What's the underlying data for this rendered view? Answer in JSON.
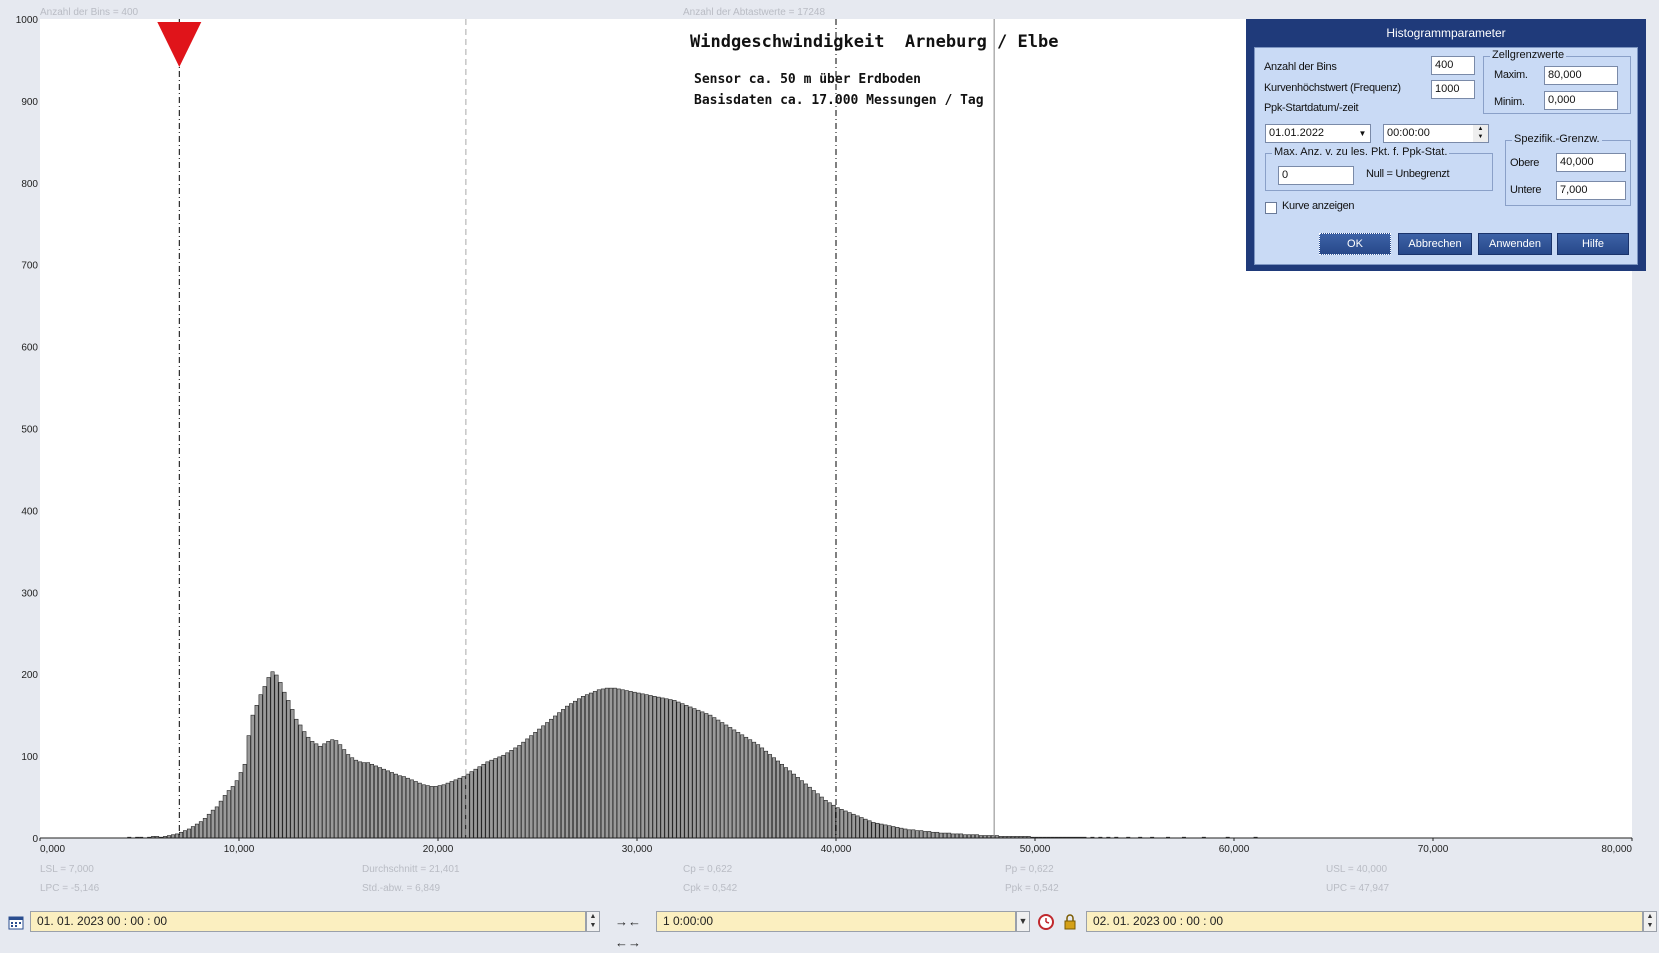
{
  "chart_data": {
    "type": "bar",
    "title": "Windgeschwindigkeit  Arneburg / Elbe",
    "subtitle_lines": [
      "Sensor ca. 50 m über Erdboden",
      "Basisdaten ca. 17.000 Messungen / Tag"
    ],
    "xlim": [
      0,
      80
    ],
    "ylim": [
      0,
      1000
    ],
    "x_ticks": [
      0,
      10,
      20,
      30,
      40,
      50,
      60,
      70,
      80
    ],
    "x_tick_labels": [
      "0,000",
      "10,000",
      "20,000",
      "30,000",
      "40,000",
      "50,000",
      "60,000",
      "70,000",
      "80,000"
    ],
    "y_ticks": [
      0,
      100,
      200,
      300,
      400,
      500,
      600,
      700,
      800,
      900,
      1000
    ],
    "y_tick_labels": [
      "0",
      "100",
      "200",
      "300",
      "400",
      "500",
      "600",
      "700",
      "800",
      "900",
      "1000"
    ],
    "bin_width": 0.2,
    "bin_start": 0,
    "values": [
      0,
      0,
      0,
      0,
      0,
      0,
      0,
      0,
      0,
      0,
      0,
      0,
      0,
      0,
      0,
      0,
      0,
      0,
      0,
      0,
      0,
      0,
      1,
      0,
      1,
      1,
      0,
      1,
      2,
      2,
      1,
      2,
      3,
      4,
      5,
      7,
      9,
      11,
      14,
      17,
      20,
      24,
      29,
      34,
      38,
      45,
      52,
      58,
      63,
      70,
      80,
      90,
      125,
      150,
      162,
      175,
      185,
      196,
      203,
      199,
      190,
      178,
      168,
      157,
      145,
      138,
      130,
      123,
      118,
      115,
      112,
      115,
      118,
      120,
      119,
      114,
      108,
      102,
      98,
      95,
      93,
      92,
      92,
      90,
      88,
      86,
      84,
      82,
      80,
      78,
      76,
      75,
      73,
      71,
      69,
      67,
      65,
      64,
      63,
      63,
      64,
      65,
      67,
      69,
      71,
      73,
      75,
      78,
      81,
      84,
      87,
      90,
      93,
      95,
      97,
      99,
      101,
      104,
      107,
      110,
      113,
      117,
      121,
      125,
      129,
      133,
      137,
      141,
      145,
      149,
      153,
      157,
      161,
      164,
      167,
      170,
      173,
      175,
      177,
      179,
      181,
      182,
      183,
      183,
      183,
      182,
      181,
      180,
      179,
      178,
      177,
      176,
      175,
      174,
      173,
      172,
      171,
      170,
      169,
      168,
      166,
      164,
      162,
      160,
      158,
      156,
      154,
      152,
      150,
      147,
      144,
      141,
      138,
      135,
      132,
      129,
      126,
      123,
      120,
      117,
      114,
      110,
      106,
      102,
      98,
      94,
      90,
      86,
      82,
      78,
      74,
      70,
      66,
      62,
      58,
      54,
      50,
      46,
      43,
      40,
      37,
      35,
      33,
      31,
      29,
      27,
      25,
      23,
      21,
      19,
      18,
      17,
      16,
      15,
      14,
      13,
      12,
      11,
      10,
      10,
      9,
      9,
      8,
      8,
      7,
      7,
      6,
      6,
      6,
      5,
      5,
      5,
      4,
      4,
      4,
      4,
      3,
      3,
      3,
      3,
      3,
      2,
      2,
      2,
      2,
      2,
      2,
      2,
      2,
      1,
      1,
      1,
      1,
      1,
      1,
      1,
      1,
      1,
      1,
      1,
      1,
      1,
      1,
      0,
      1,
      0,
      1,
      0,
      1,
      0,
      1,
      0,
      0,
      1,
      0,
      0,
      1,
      0,
      0,
      1,
      0,
      0,
      0,
      1,
      0,
      0,
      0,
      1,
      0,
      0,
      0,
      0,
      1,
      0,
      0,
      0,
      0,
      0,
      1,
      0,
      0,
      0,
      0,
      0,
      0,
      1,
      0,
      0,
      0,
      0,
      0,
      0,
      0,
      0,
      0,
      0,
      0,
      0,
      0,
      0,
      0,
      0,
      0,
      0,
      0,
      0,
      0,
      0,
      0,
      0,
      0,
      0,
      0,
      0,
      0,
      0,
      0,
      0,
      0,
      0,
      0,
      0,
      0,
      0,
      0,
      0,
      0,
      0,
      0,
      0,
      0,
      0,
      0,
      0,
      0,
      0,
      0,
      0,
      0,
      0,
      0,
      0,
      0,
      0,
      0,
      0,
      0,
      0,
      0,
      0,
      0,
      0,
      0,
      0,
      0,
      0,
      0,
      0,
      0,
      0,
      0,
      0,
      0,
      0,
      0,
      0,
      0,
      0,
      0,
      0,
      0,
      0,
      0,
      0,
      0,
      0,
      0,
      0,
      0,
      0,
      0,
      0,
      0
    ],
    "vlines": [
      {
        "x": 7.0,
        "style": "dashdot",
        "color": "#000000",
        "marker": "triangle"
      },
      {
        "x": 21.401,
        "style": "dashed",
        "color": "#aaaaaa"
      },
      {
        "x": 40.0,
        "style": "dashdot",
        "color": "#000000"
      },
      {
        "x": 47.947,
        "style": "solid",
        "color": "#888888"
      }
    ],
    "grid": false,
    "bar_color": "#9a9a9a",
    "marker_color": "#e0141a"
  },
  "header_stats": {
    "bins": "Anzahl der Bins =   400",
    "samples": "Anzahl der Abtastwerte = 17248"
  },
  "footer_stats": [
    [
      "LSL = 7,000",
      "LPC = -5,146"
    ],
    [
      "Durchschnitt  = 21,401",
      "Std.-abw. = 6,849"
    ],
    [
      "Cp = 0,622",
      "Cpk = 0,542"
    ],
    [
      "Pp = 0,622",
      "Ppk = 0,542"
    ],
    [
      "USL = 40,000",
      "UPC = 47,947"
    ]
  ],
  "toolbar": {
    "calendar_icon": "calendar-icon",
    "start_datetime": "01. 01. 2023   00 : 00 : 00",
    "zoom_icons": "→← ←→",
    "duration": "1 0:00:00",
    "end_datetime": "02. 01. 2023    00 : 00 : 00",
    "clock_icon": "clock-icon",
    "lock_icon": "lock-icon"
  },
  "dialog": {
    "title": "Histogrammparameter",
    "bins_label": "Anzahl der Bins",
    "bins_value": "400",
    "max_freq_label": "Kurvenhöchstwert (Frequenz)",
    "max_freq_value": "1000",
    "ppk_start_label": "Ppk-Startdatum/-zeit",
    "ppk_date": "01.01.2022",
    "ppk_time": "00:00:00",
    "cell_limits_title": "Zellgrenzwerte",
    "max_label": "Maxim.",
    "max_value": "80,000",
    "min_label": "Minim.",
    "min_value": "0,000",
    "max_points_title": "Max. Anz. v. zu les. Pkt. f. Ppk-Stat.",
    "max_points_value": "0",
    "null_hint": "Null = Unbegrenzt",
    "spec_title": "Spezifik.-Grenzw.",
    "upper_label": "Obere",
    "upper_value": "40,000",
    "lower_label": "Untere",
    "lower_value": "7,000",
    "show_curve_label": "Kurve anzeigen",
    "show_curve_checked": false,
    "ok": "OK",
    "cancel": "Abbrechen",
    "apply": "Anwenden",
    "help": "Hilfe"
  }
}
